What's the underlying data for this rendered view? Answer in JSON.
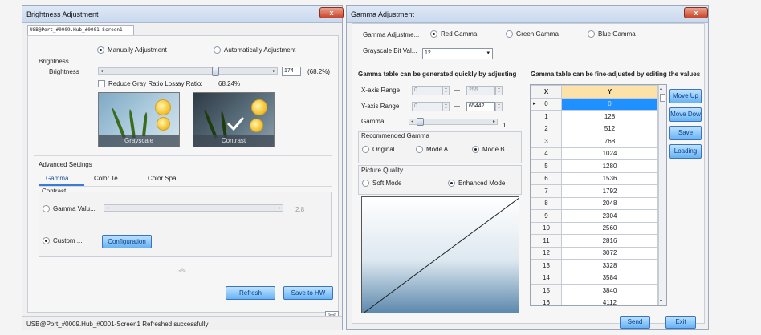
{
  "left_window": {
    "title": "Brightness Adjustment",
    "close_label": "x",
    "device_tab": "USB@Port_#0009.Hub_#0001-Screen1",
    "mode_manual": "Manually Adjustment",
    "mode_auto": "Automatically Adjustment",
    "brightness_group": "Brightness",
    "brightness_label": "Brightness",
    "brightness_value": "174",
    "brightness_percent": "(68.2%)",
    "brightness_level": 0.682,
    "reduce_gray_label": "Reduce Gray Ratio Loss",
    "gray_ratio_label": "ay Ratio:",
    "gray_ratio_value": "68.24%",
    "image_grayscale": "Grayscale",
    "image_contrast": "Contrast",
    "advanced_group": "Advanced Settings",
    "tabs": [
      "Gamma ...",
      "Color Te...",
      "Color Spa..."
    ],
    "contrast_label": "Contrast",
    "gamma_value_label": "Gamma Valu...",
    "gamma_value": "2.8",
    "custom_label": "Custom ...",
    "configuration_button": "Configuration",
    "refresh_button": "Refresh",
    "save_hw_button": "Save to HW",
    "status": "USB@Port_#0009.Hub_#0001-Screen1 Refreshed successfully"
  },
  "right_window": {
    "title": "Gamma Adjustment",
    "close_label": "x",
    "gamma_adjust_label": "Gamma Adjustme...",
    "color_options": [
      "Red Gamma",
      "Green Gamma",
      "Blue Gamma"
    ],
    "selected_color": "Red Gamma",
    "bit_label": "Grayscale Bit Val...",
    "bit_value": "12",
    "quick_adjust_heading": "Gamma table can be generated quickly by adjusting",
    "x_range_label": "X-axis Range",
    "x_min": "0",
    "x_max": "255",
    "y_range_label": "Y-axis Range",
    "y_min": "0",
    "y_max": "65442",
    "range_sep": "—",
    "gamma_label": "Gamma",
    "gamma_value": "1",
    "recommended_label": "Recommended Gamma",
    "recommended_options": [
      "Original",
      "Mode A",
      "Mode B"
    ],
    "selected_recommended": "Mode B",
    "picture_quality_label": "Picture Quality",
    "quality_options": [
      "Soft Mode",
      "Enhanced Mode"
    ],
    "selected_quality": "Enhanced Mode",
    "fine_adjust_heading": "Gamma table can be fine-adjusted by editing the values",
    "table_headers": [
      "X",
      "Y"
    ],
    "table_rows": [
      [
        "0",
        "0"
      ],
      [
        "1",
        "128"
      ],
      [
        "2",
        "512"
      ],
      [
        "3",
        "768"
      ],
      [
        "4",
        "1024"
      ],
      [
        "5",
        "1280"
      ],
      [
        "6",
        "1536"
      ],
      [
        "7",
        "1792"
      ],
      [
        "8",
        "2048"
      ],
      [
        "9",
        "2304"
      ],
      [
        "10",
        "2560"
      ],
      [
        "11",
        "2816"
      ],
      [
        "12",
        "3072"
      ],
      [
        "13",
        "3328"
      ],
      [
        "14",
        "3584"
      ],
      [
        "15",
        "3840"
      ],
      [
        "16",
        "4112"
      ]
    ],
    "side_buttons": [
      "Move Up",
      "Move Dow",
      "Save",
      "Loading"
    ],
    "send_button": "Send",
    "exit_button": "Exit"
  }
}
